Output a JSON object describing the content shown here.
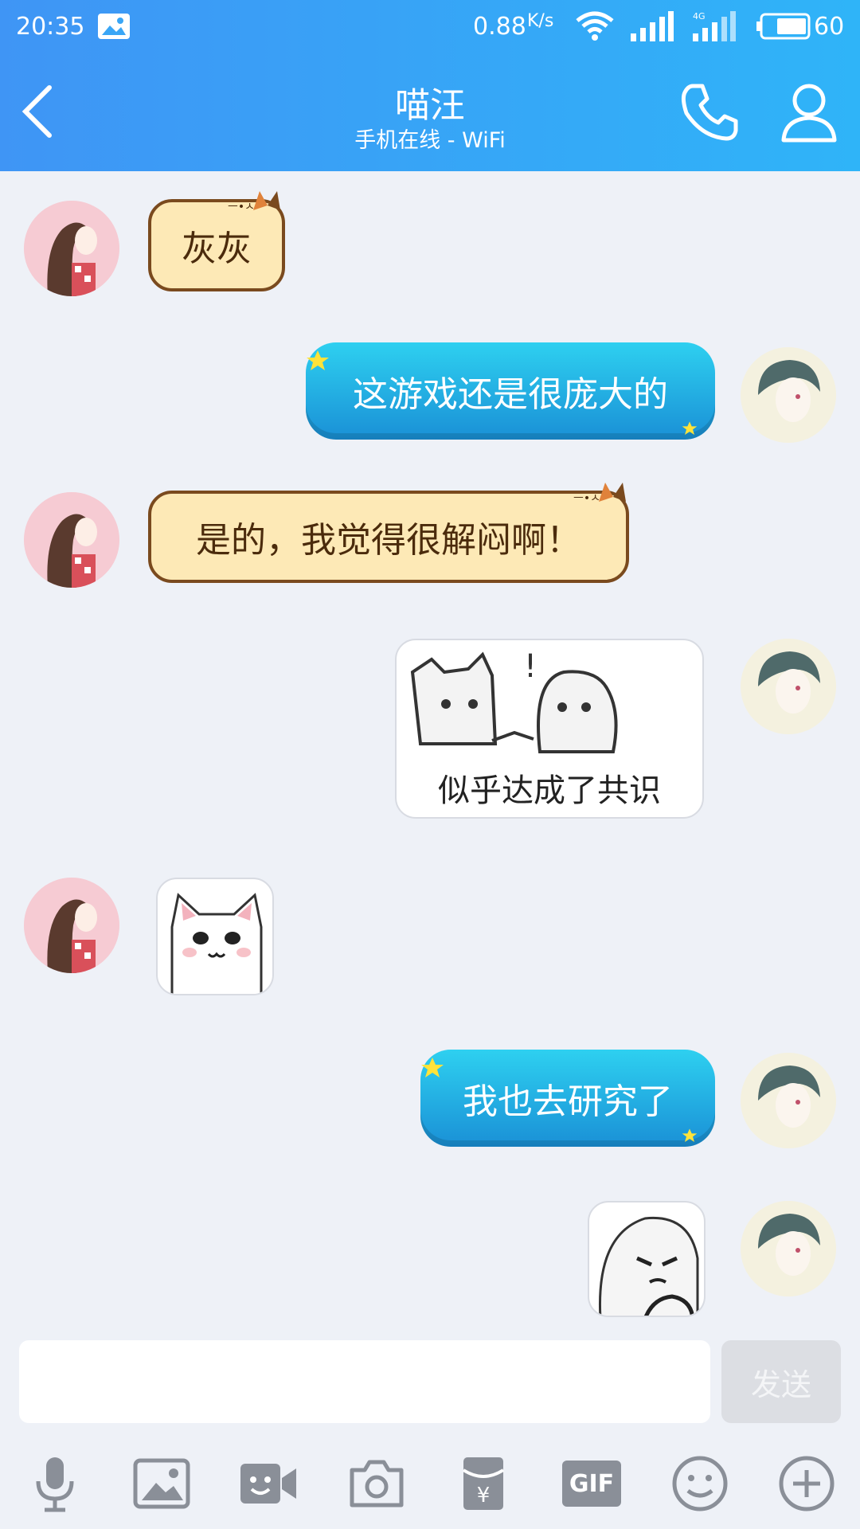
{
  "status_bar": {
    "time": "20:35",
    "speed": "0.88",
    "speed_unit": "K/s",
    "battery": "60"
  },
  "header": {
    "title": "喵汪",
    "subtitle": "手机在线 - WiFi"
  },
  "messages": [
    {
      "side": "left",
      "type": "text",
      "text": "灰灰"
    },
    {
      "side": "right",
      "type": "text",
      "text": "这游戏还是很庞大的"
    },
    {
      "side": "left",
      "type": "text",
      "text": "是的，我觉得很解闷啊！"
    },
    {
      "side": "right",
      "type": "sticker",
      "caption": "似乎达成了共识"
    },
    {
      "side": "left",
      "type": "sticker"
    },
    {
      "side": "right",
      "type": "text",
      "text": "我也去研究了"
    },
    {
      "side": "right",
      "type": "sticker"
    }
  ],
  "composer": {
    "input_value": "",
    "send_label": "发送"
  },
  "toolbar": {
    "icons": [
      "microphone-icon",
      "image-icon",
      "video-icon",
      "camera-icon",
      "red-packet-icon",
      "gif-icon",
      "emoji-icon",
      "plus-icon"
    ],
    "gif_label": "GIF"
  },
  "colors": {
    "header_start": "#3f95f5",
    "header_end": "#2fb4f8",
    "background": "#eef1f7",
    "cat_bubble": "#fde9b6",
    "blue_bubble": "#1a90d6"
  }
}
